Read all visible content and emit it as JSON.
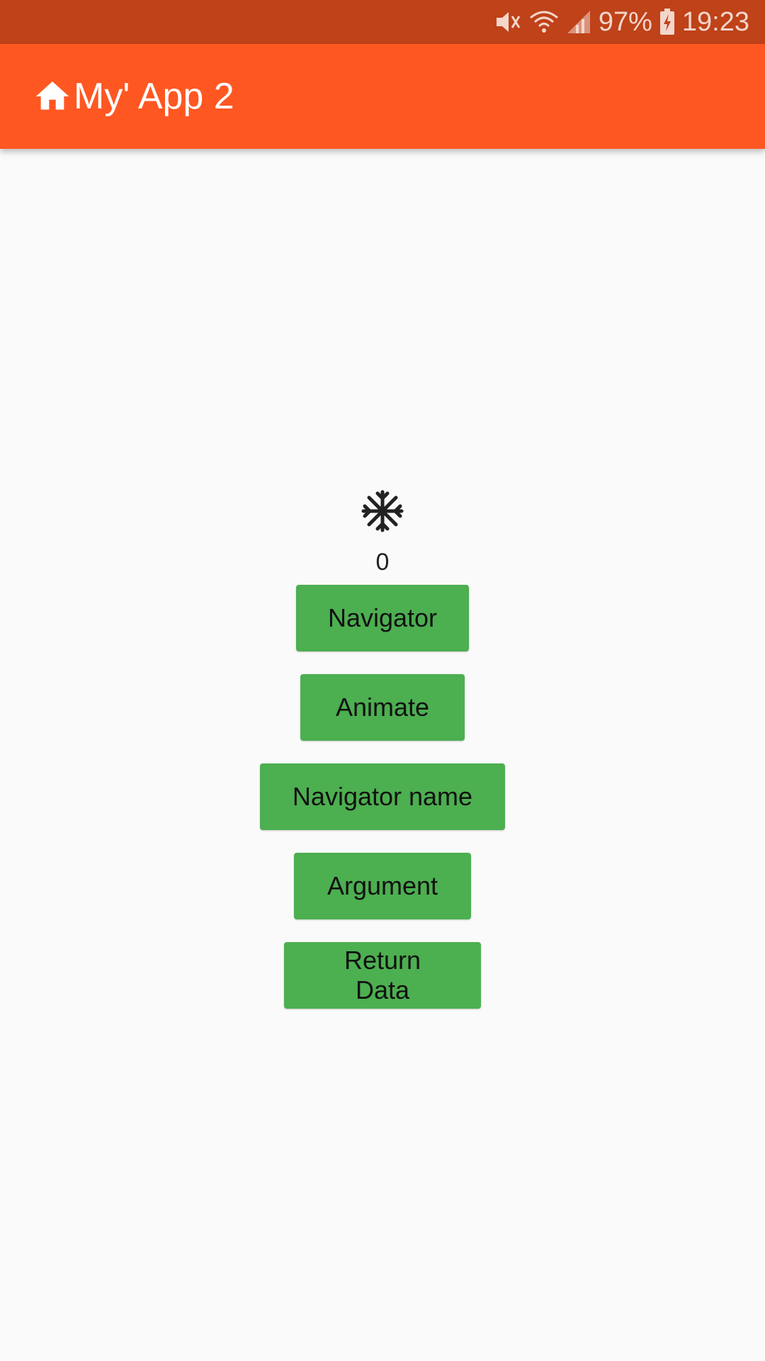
{
  "status_bar": {
    "icons": [
      "mute-vibrate-icon",
      "wifi-icon",
      "signal-icon",
      "battery-charging-icon"
    ],
    "battery": "97%",
    "time": "19:23"
  },
  "app_bar": {
    "icon": "home-icon",
    "title": "My' App 2",
    "background": "#ff5722"
  },
  "main": {
    "icon": "snowflake-icon",
    "counter": "0",
    "buttons": [
      {
        "label": "Navigator"
      },
      {
        "label": "Animate"
      },
      {
        "label": "Navigator name"
      },
      {
        "label": "Argument"
      },
      {
        "label": "Return Data"
      }
    ],
    "button_color": "#4caf50"
  }
}
